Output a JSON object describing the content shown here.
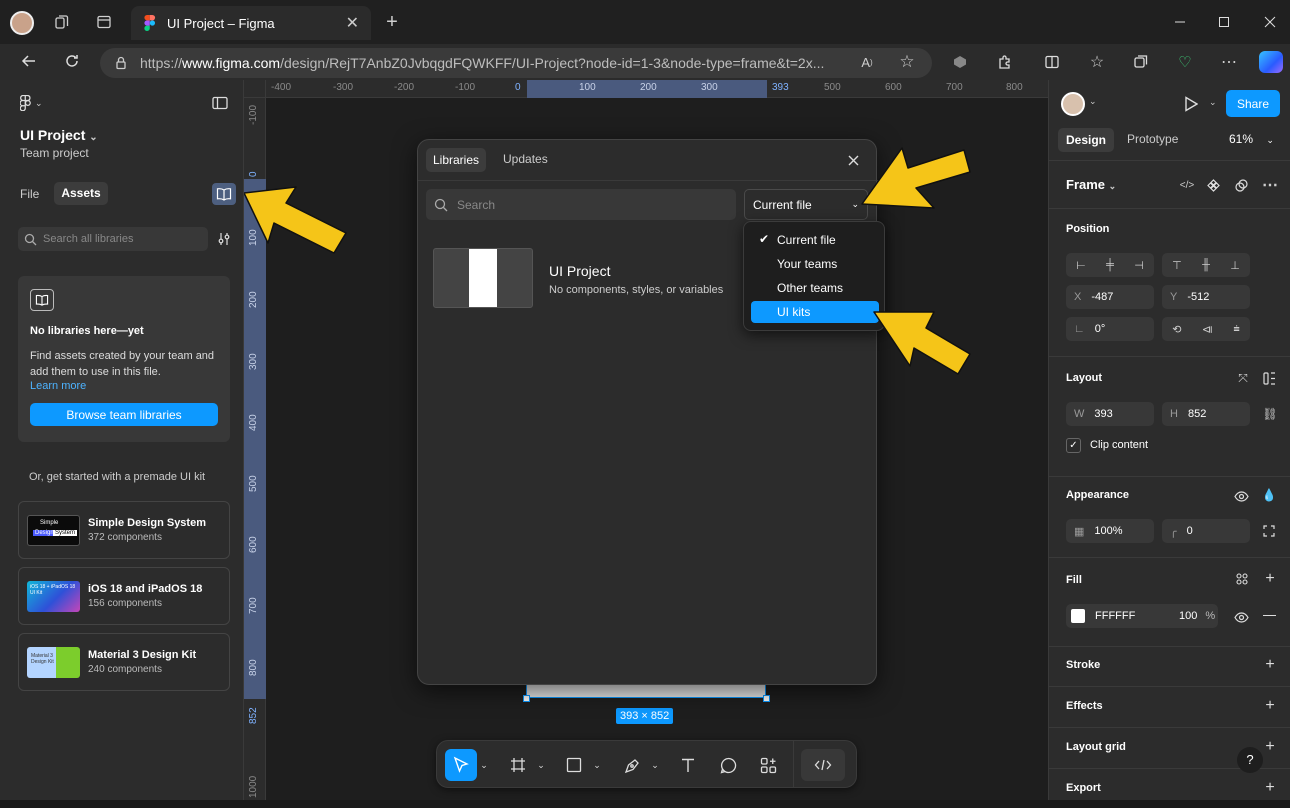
{
  "browser": {
    "tab_title": "UI Project – Figma",
    "url_prefix": "https://",
    "url_domain": "www.figma.com",
    "url_path": "/design/RejT7AnbZ0JvbqgdFQWKFF/UI-Project?node-id=1-3&node-type=frame&t=2x..."
  },
  "left_panel": {
    "project_name": "UI Project",
    "project_sub": "Team project",
    "tabs": [
      {
        "label": "File"
      },
      {
        "label": "Assets"
      }
    ],
    "search_placeholder": "Search all libraries",
    "empty_title": "No libraries here—yet",
    "empty_body": "Find assets created by your team and add them to use in this file.",
    "learn_more": "Learn more",
    "browse_button": "Browse team libraries",
    "premade_label": "Or, get started with a premade UI kit",
    "kits": [
      {
        "name": "Simple Design System",
        "count": "372 components"
      },
      {
        "name": "iOS 18 and iPadOS 18",
        "count": "156 components"
      },
      {
        "name": "Material 3 Design Kit",
        "count": "240 components"
      }
    ],
    "kit_thumb_text": [
      "Simple",
      "Design",
      "System",
      "iOS 18 + iPadOS 18",
      "UI Kit",
      "Material 3",
      "Design Kit"
    ]
  },
  "rulers": {
    "h": [
      "-400",
      "-300",
      "-200",
      "-100",
      "0",
      "100",
      "200",
      "300",
      "393",
      "500",
      "600",
      "700",
      "800"
    ],
    "v": [
      "-100",
      "0",
      "100",
      "200",
      "300",
      "400",
      "500",
      "600",
      "700",
      "800",
      "852",
      "1000"
    ]
  },
  "modal": {
    "tabs": [
      "Libraries",
      "Updates"
    ],
    "search_placeholder": "Search",
    "scope_select": "Current file",
    "library_name": "UI Project",
    "library_desc": "No components, styles, or variables",
    "dropdown_options": [
      "Current file",
      "Your teams",
      "Other teams",
      "UI kits"
    ],
    "checked_option": "Current file",
    "highlighted_option": "UI kits"
  },
  "canvas": {
    "frame_size_label": "393 × 852"
  },
  "right_panel": {
    "tabs": [
      "Design",
      "Prototype"
    ],
    "zoom": "61%",
    "share": "Share",
    "frame_label": "Frame",
    "position_title": "Position",
    "x_label": "X",
    "x_value": "-487",
    "y_label": "Y",
    "y_value": "-512",
    "rotation": "0°",
    "layout_title": "Layout",
    "w_label": "W",
    "w_value": "393",
    "h_label": "H",
    "h_value": "852",
    "clip_content": "Clip content",
    "appearance_title": "Appearance",
    "opacity": "100%",
    "radius": "0",
    "fill_title": "Fill",
    "fill_hex": "FFFFFF",
    "fill_opacity": "100",
    "fill_pct": "%",
    "sections": [
      "Stroke",
      "Effects",
      "Layout grid",
      "Export"
    ],
    "help": "?"
  },
  "colors": {
    "accent": "#0d99ff",
    "arrow": "#f5c518",
    "ruler_highlight": "#4a5a7e"
  }
}
